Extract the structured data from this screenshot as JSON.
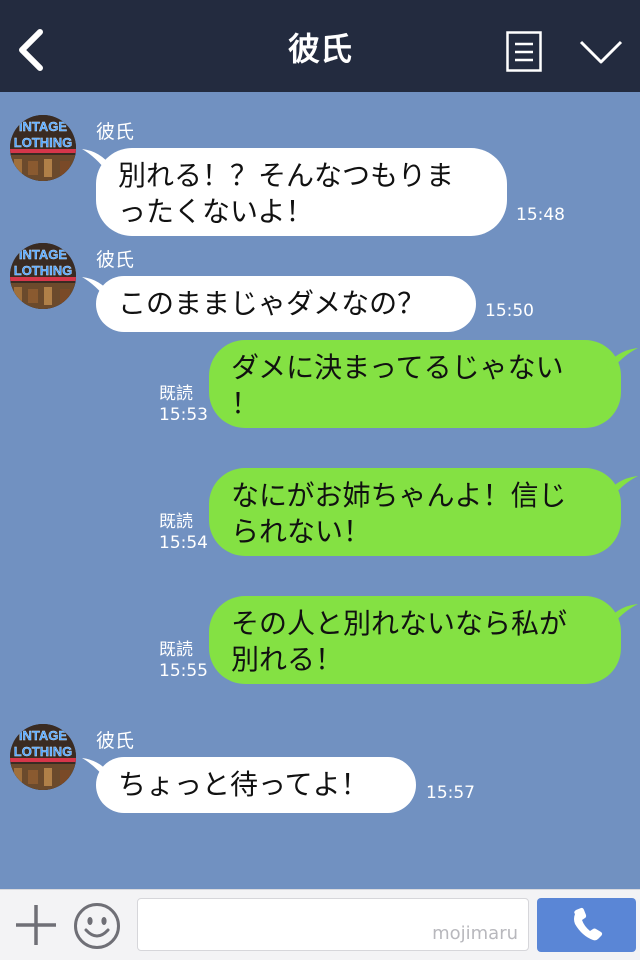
{
  "header": {
    "title": "彼氏",
    "back_icon": "chevron-left-icon",
    "menu_icon": "list-menu-icon",
    "collapse_icon": "chevron-down-icon"
  },
  "messages": [
    {
      "direction": "incoming",
      "sender": "彼氏",
      "lines": [
        "別れる！？そんなつもりま",
        "ったくないよ！"
      ],
      "time": "15:48"
    },
    {
      "direction": "incoming",
      "sender": "彼氏",
      "lines": [
        "このままじゃダメなの？"
      ],
      "time": "15:50"
    },
    {
      "direction": "outgoing",
      "read": "既読",
      "lines": [
        "ダメに決まってるじゃない",
        "！"
      ],
      "time": "15:53"
    },
    {
      "direction": "outgoing",
      "read": "既読",
      "lines": [
        "なにがお姉ちゃんよ！信じ",
        "られない！"
      ],
      "time": "15:54"
    },
    {
      "direction": "outgoing",
      "read": "既読",
      "lines": [
        "その人と別れないなら私が",
        "別れる！"
      ],
      "time": "15:55"
    },
    {
      "direction": "incoming",
      "sender": "彼氏",
      "lines": [
        "ちょっと待ってよ！"
      ],
      "time": "15:57"
    }
  ],
  "avatar": {
    "sign_line1": "INTAGE",
    "sign_line2": "LOTHING"
  },
  "footer": {
    "input_value": "",
    "watermark": "mojimaru",
    "call_icon": "phone-icon",
    "plus_icon": "plus-icon",
    "emoji_icon": "smiley-icon"
  },
  "colors": {
    "header_bg": "#232b3f",
    "chat_bg": "#7191c1",
    "outgoing_bubble": "#84e143",
    "incoming_bubble": "#ffffff",
    "call_button": "#5a86d6"
  }
}
